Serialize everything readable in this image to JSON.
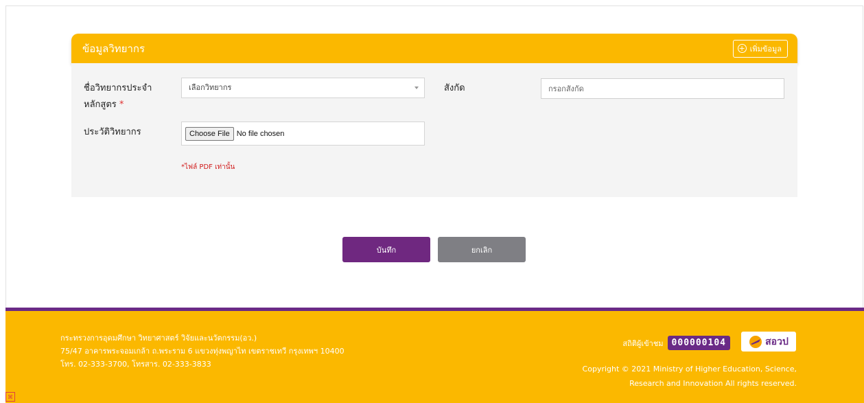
{
  "section": {
    "title": "ข้อมูลวิทยากร",
    "add_button_label": "เพิ่มข้อมูล",
    "add_icon": "plus-circle-icon"
  },
  "form": {
    "lecturer_label_line1": "ชื่อวิทยากรประจำ",
    "lecturer_label_line2": "หลักสูตร",
    "required_mark": "*",
    "lecturer_select_value": "เลือกวิทยากร",
    "affiliation_label": "สังกัด",
    "affiliation_placeholder": "กรอกสังกัด",
    "resume_label": "ประวัติวิทยากร",
    "choose_file_label": "Choose File",
    "no_file_text": "No file chosen",
    "pdf_note": "*ไฟล์ PDF เท่านั้น"
  },
  "actions": {
    "save_label": "บันทึก",
    "cancel_label": "ยกเลิก"
  },
  "footer": {
    "address_line1": "กระทรวงการอุดมศึกษา วิทยาศาสตร์ วิจัยและนวัตกรรม(อว.)",
    "address_line2": "75/47 อาคารพระจอมเกล้า ถ.พระราม 6 แขวงทุ่งพญาไท เขตราชเทวี กรุงเทพฯ 10400",
    "address_line3": "โทร. 02-333-3700, โทรสาร. 02-333-3833",
    "visitor_label": "สถิติผู้เข้าชม",
    "visitor_count": "000000104",
    "logo_text": "สอวป",
    "copyright_line1": "Copyright © 2021 Ministry of Higher Education, Science,",
    "copyright_line2": "Research and Innovation All rights reserved."
  },
  "colors": {
    "accent_yellow": "#fbb800",
    "brand_purple": "#6f2880",
    "cancel_gray": "#7f7f84",
    "required_red": "#e0302f"
  }
}
